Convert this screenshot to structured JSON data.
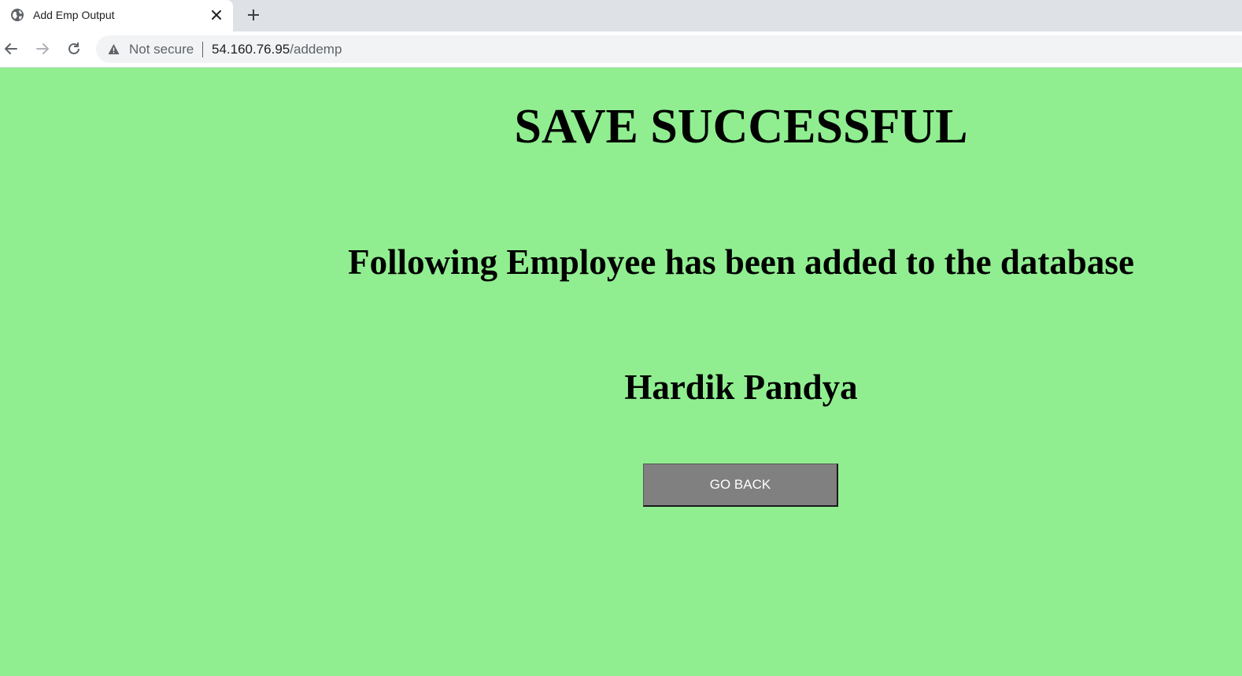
{
  "browser": {
    "tab": {
      "title": "Add Emp Output",
      "favicon": "globe-icon",
      "close_icon": "close-icon"
    },
    "new_tab_icon": "plus-icon",
    "toolbar": {
      "back_icon": "arrow-left-icon",
      "forward_icon": "arrow-right-icon",
      "reload_icon": "reload-icon"
    },
    "address_bar": {
      "security_icon": "warning-triangle-icon",
      "security_label": "Not secure",
      "url_host": "54.160.76.95",
      "url_path": "/addemp"
    }
  },
  "page": {
    "background_color": "#90ee90",
    "title": "SAVE SUCCESSFUL",
    "subtitle": "Following Employee has been added to the database",
    "employee_name": "Hardik Pandya",
    "go_back_label": "GO BACK",
    "button_color": "#808080"
  }
}
